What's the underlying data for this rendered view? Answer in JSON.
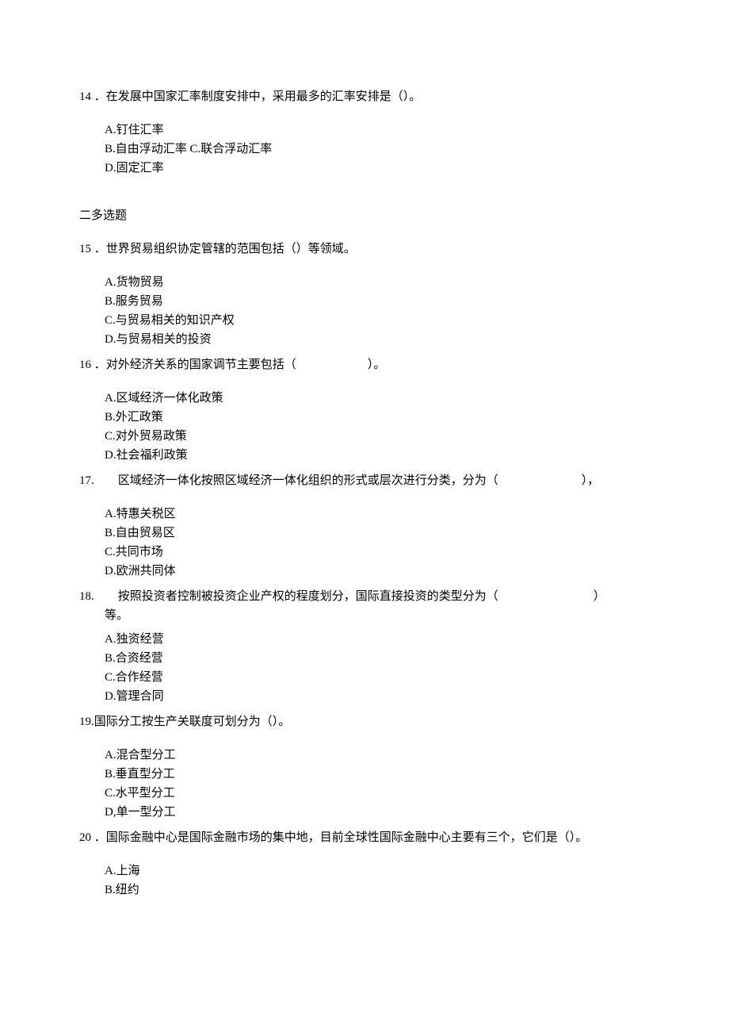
{
  "q14": {
    "num": "14",
    "sep": " ．",
    "text": "在发展中国家汇率制度安排中，采用最多的汇率安排是（）。",
    "A": "A.钉住汇率",
    "B": "B.自由浮动汇率 C.联合浮动汇率",
    "D": "D.固定汇率"
  },
  "section2": "二多选题",
  "q15": {
    "num": "15",
    "sep": " ．",
    "text": "世界贸易组织协定管辖的范围包括（）等领域。",
    "A": "A.货物贸易",
    "B": "B.服务贸易",
    "C": "C.与贸易相关的知识产权",
    "D": "D.与贸易相关的投资"
  },
  "q16": {
    "num": "16",
    "sep": " ．",
    "text": "对外经济关系的国家调节主要包括（　　　　　　）。",
    "A": "A.区域经济一体化政策",
    "B": "B.外汇政策",
    "C": "C.对外贸易政策",
    "D": "D.社会福利政策"
  },
  "q17": {
    "num": "17.",
    "sep": "　　",
    "text": "区域经济一体化按照区域经济一体化组织的形式或层次进行分类，分为（　　　　　　　），",
    "A": "A.特惠关税区",
    "B": "B.自由贸易区",
    "C": "C.共同市场",
    "D": "D.欧洲共同体"
  },
  "q18": {
    "num": "18.",
    "sep": "　　",
    "text": "按照投资者控制被投资企业产权的程度划分，国际直接投资的类型分为（　　　　　　　　）",
    "text2": "等。",
    "A": "A.独资经营",
    "B": "B.合资经营",
    "C": "C.合作经营",
    "D": "D.管理合同"
  },
  "q19": {
    "num": "19.",
    "text": "国际分工按生产关联度可划分为（）。",
    "A": "A.混合型分工",
    "B": "B.垂直型分工",
    "C": "C.水平型分工",
    "D": "D,单一型分工"
  },
  "q20": {
    "num": "20",
    "sep": " ．",
    "text": "国际金融中心是国际金融市场的集中地，目前全球性国际金融中心主要有三个，它们是（）。",
    "A": "A.上海",
    "B": "B.纽约"
  }
}
